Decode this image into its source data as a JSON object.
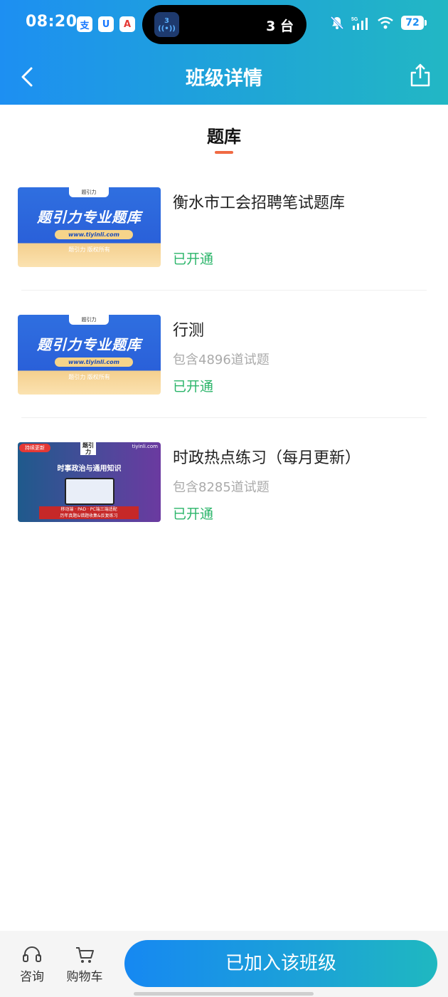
{
  "status_bar": {
    "time": "08:20",
    "app_icons": [
      "支",
      "U",
      "A"
    ],
    "island_badge": "3",
    "island_text": "3 台",
    "battery": "72"
  },
  "nav": {
    "title": "班级详情"
  },
  "section": {
    "title": "题库",
    "accent_color": "#f06a43"
  },
  "items": [
    {
      "title": "衡水市工会招聘笔试题库",
      "subtitle": "",
      "status": "已开通",
      "thumb": {
        "badge": "题引力",
        "headline": "题引力专业题库",
        "url": "www.tiyinli.com",
        "copyright": "题引力 版权所有"
      }
    },
    {
      "title": "行测",
      "subtitle": "包含4896道试题",
      "status": "已开通",
      "thumb": {
        "badge": "题引力",
        "headline": "题引力专业题库",
        "url": "www.tiyinli.com",
        "copyright": "题引力 版权所有"
      }
    },
    {
      "title": "时政热点练习（每月更新）",
      "subtitle": "包含8285道试题",
      "status": "已开通",
      "thumb": {
        "tag": "持续更新",
        "site": "tiyinli.com",
        "logo": "题引力",
        "headline": "时事政治与通用知识",
        "strip_line1": "移动端 · PAD · PC端三端适配",
        "strip_line2": "历年真题&错题收集&反复练习"
      }
    }
  ],
  "bottom_bar": {
    "consult_label": "咨询",
    "cart_label": "购物车",
    "join_label": "已加入该班级"
  },
  "colors": {
    "status_green": "#2bb56a",
    "header_gradient_start": "#1d8ff2",
    "header_gradient_end": "#22b7c4"
  }
}
